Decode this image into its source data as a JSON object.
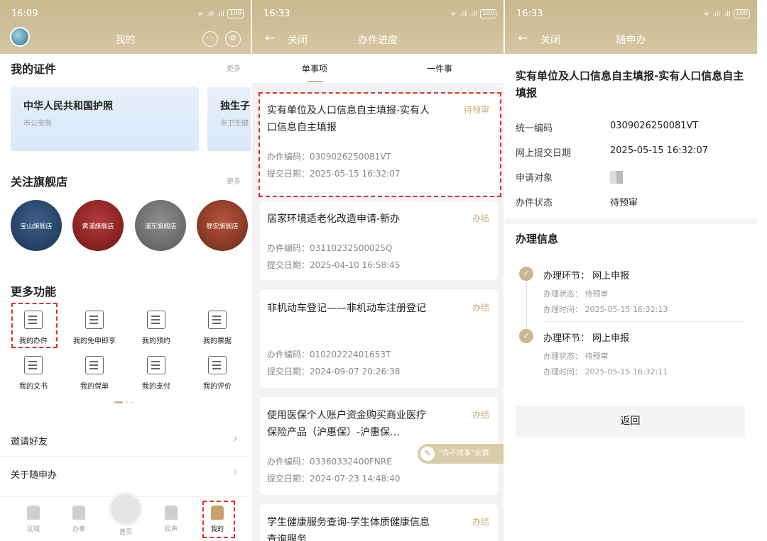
{
  "panel1": {
    "time": "16:09",
    "signal": "ᯤ .ıll .ıll",
    "battery": "100",
    "title": "我的",
    "certs": {
      "heading": "我的证件",
      "more": "更多",
      "cards": [
        {
          "title": "中华人民共和国护照",
          "issuer": "市公安局"
        },
        {
          "title": "独生子",
          "issuer": "市卫生健"
        }
      ]
    },
    "stores": {
      "heading": "关注旗舰店",
      "more": "更多",
      "items": [
        "宝山旗舰店",
        "黄浦旗舰店",
        "浦东旗舰店",
        "静安旗舰店"
      ]
    },
    "functions": {
      "heading": "更多功能",
      "items": [
        "我的办件",
        "我的免申即享",
        "我的预约",
        "我的票据",
        "我的文书",
        "我的保单",
        "我的支付",
        "我的评价"
      ]
    },
    "rows": [
      "邀请好友",
      "关于随申办"
    ],
    "tabbar": [
      "区域",
      "办事",
      "首页",
      "民声",
      "我的"
    ]
  },
  "panel2": {
    "time": "16:33",
    "signal": "ᯤ .ıll .ıll",
    "battery": "100",
    "close": "关闭",
    "title": "办件进度",
    "tabs": [
      "单事项",
      "一件事"
    ],
    "code_label": "办件编码：",
    "date_label": "提交日期：",
    "items": [
      {
        "title": "实有单位及人口信息自主填报-实有人口信息自主填报",
        "status": "待预审",
        "code": "0309026250081VT",
        "date": "2025-05-15 16:32:07"
      },
      {
        "title": "居家环境适老化改造申请-新办",
        "status": "办结",
        "code": "03110232500025Q",
        "date": "2025-04-10 16:58:45"
      },
      {
        "title": "非机动车登记——非机动车注册登记",
        "status": "办结",
        "code": "01020222401653T",
        "date": "2024-09-07 20:26:38"
      },
      {
        "title": "使用医保个人账户资金购买商业医疗保险产品（沪惠保）-沪惠保…",
        "status": "办结",
        "code": "03360332400FNRE",
        "date": "2024-07-23 14:48:40"
      },
      {
        "title": "学生健康服务查询-学生体质健康信息查询服务",
        "status": "办结"
      }
    ],
    "feedback": "“办不成事”反馈"
  },
  "panel3": {
    "time": "16:33",
    "signal": "ᯤ .ıll .ıll",
    "battery": "100",
    "close": "关闭",
    "title": "随申办",
    "heading": "实有单位及人口信息自主填报-实有人口信息自主填报",
    "fields": [
      {
        "label": "统一编码",
        "value": "0309026250081VT"
      },
      {
        "label": "网上提交日期",
        "value": "2025-05-15 16:32:07"
      },
      {
        "label": "申请对象",
        "value": ""
      },
      {
        "label": "办件状态",
        "value": "待预审"
      }
    ],
    "proc_heading": "办理信息",
    "steps": [
      {
        "stage": "办理环节：  网上申报",
        "state": "办理状态：  待预审",
        "time": "办理时间：  2025-05-15 16:32:13"
      },
      {
        "stage": "办理环节：  网上申报",
        "state": "办理状态：  待预审",
        "time": "办理时间：  2025-05-15 16:32:11"
      }
    ],
    "back_button": "返回"
  },
  "colors": {
    "accent": "#c9b88f",
    "status_pending": "#c9b07a",
    "highlight": "#e0302c"
  }
}
